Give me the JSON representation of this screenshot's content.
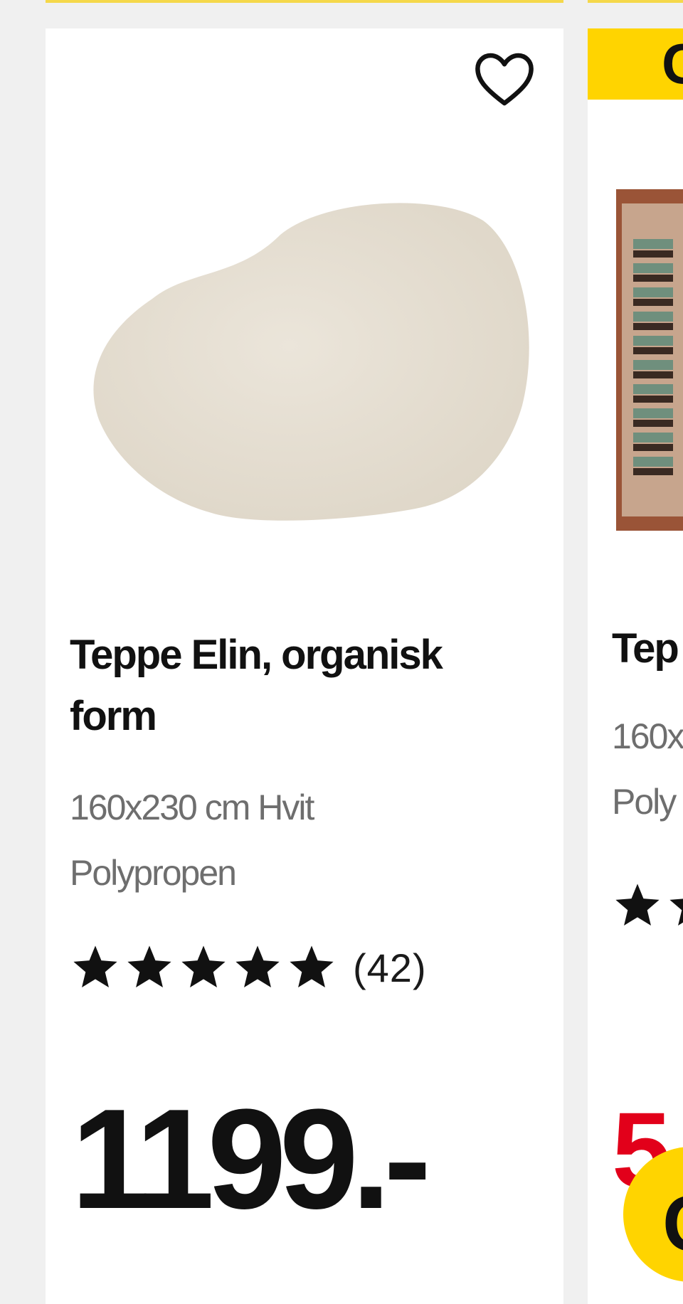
{
  "products": [
    {
      "title": "Teppe Elin, organisk form",
      "dimensions": "160x230 cm Hvit",
      "material": "Polypropen",
      "rating": 5,
      "rating_max": 5,
      "review_count": "(42)",
      "price": "1199.-",
      "favorite_icon": "heart-outline-icon",
      "image_color": "#e8e2d6"
    },
    {
      "badge": "C",
      "title": "Tep",
      "dimensions": "160x",
      "material": "Poly",
      "price": "5",
      "splash_text": "C",
      "badge_color": "#ffd400",
      "price_color": "#e2001a"
    }
  ],
  "colors": {
    "accent_yellow": "#ffd400",
    "sale_red": "#e2001a",
    "star": "#111111",
    "muted_text": "#6e6e6e"
  }
}
